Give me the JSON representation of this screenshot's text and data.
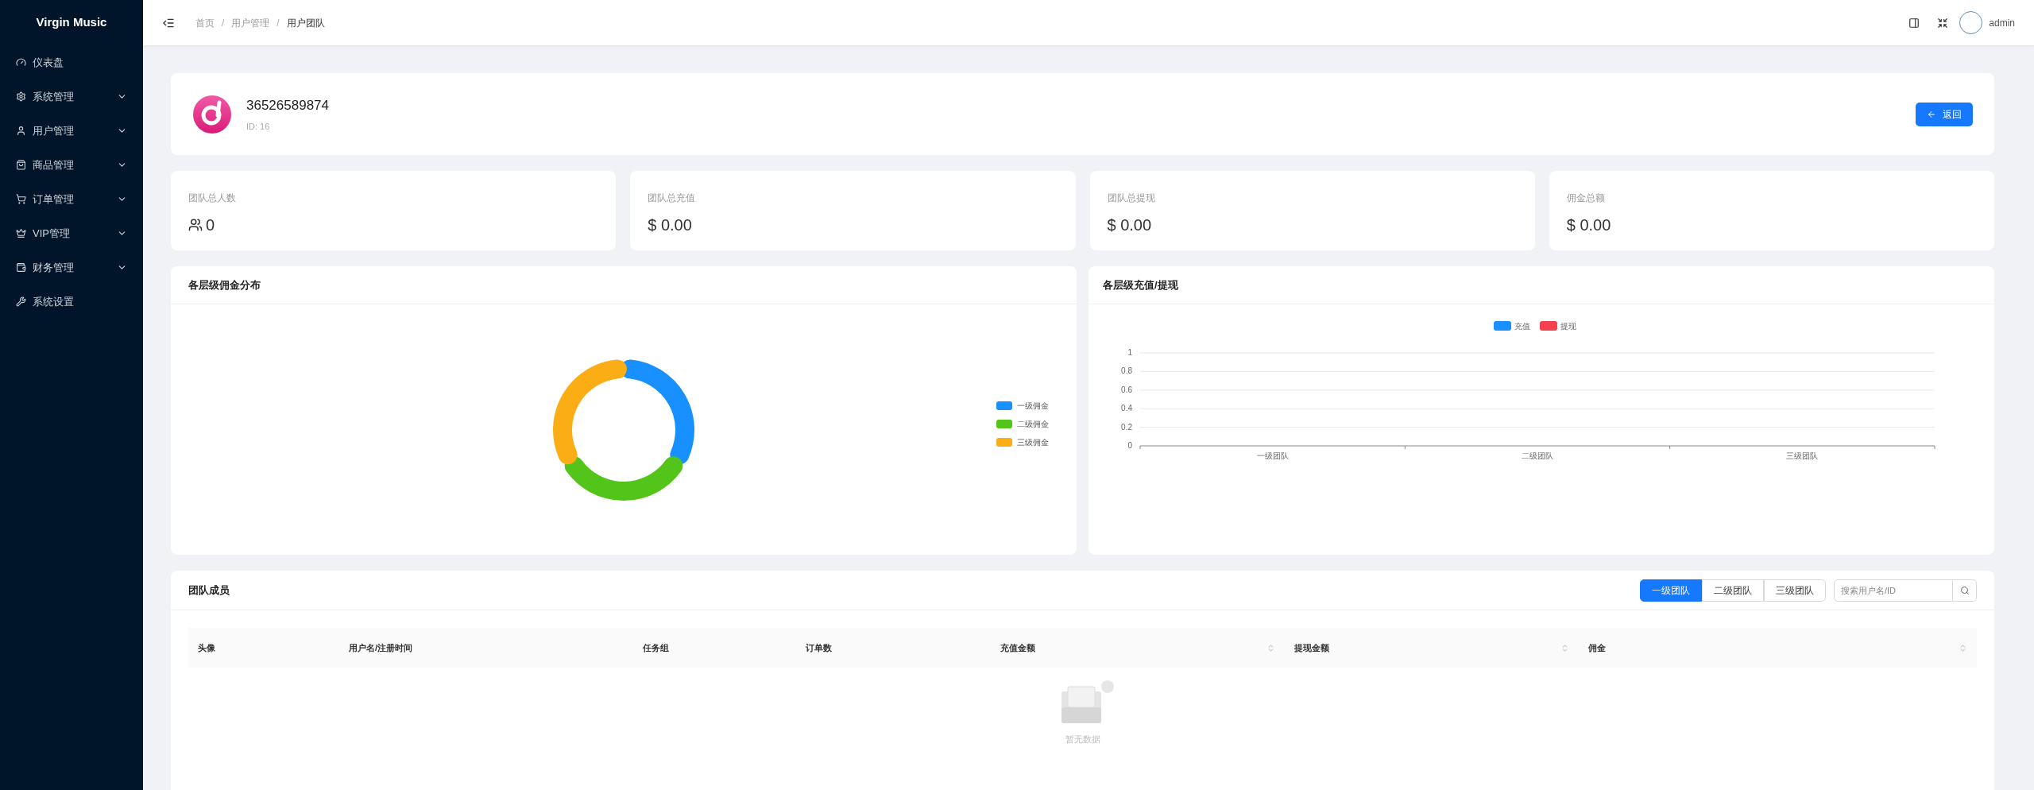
{
  "sidebar": {
    "brand": "Virgin Music",
    "items": [
      {
        "label": "仪表盘",
        "kind": "link"
      },
      {
        "label": "系统管理",
        "kind": "group"
      },
      {
        "label": "用户管理",
        "kind": "group"
      },
      {
        "label": "商品管理",
        "kind": "group"
      },
      {
        "label": "订单管理",
        "kind": "group"
      },
      {
        "label": "VIP管理",
        "kind": "group"
      },
      {
        "label": "财务管理",
        "kind": "group"
      },
      {
        "label": "系统设置",
        "kind": "link"
      }
    ]
  },
  "header": {
    "breadcrumb": [
      "首页",
      "用户管理",
      "用户团队"
    ],
    "separator": "/",
    "user": "admin"
  },
  "profile": {
    "name": "36526589874",
    "id_text": "ID: 16",
    "back_button": "返回"
  },
  "stats": [
    {
      "label": "团队总人数",
      "value": "0",
      "kind": "count"
    },
    {
      "label": "团队总充值",
      "value": "$ 0.00",
      "kind": "money"
    },
    {
      "label": "团队总提现",
      "value": "$ 0.00",
      "kind": "money"
    },
    {
      "label": "佣金总额",
      "value": "$ 0.00",
      "kind": "money"
    }
  ],
  "commission_chart": {
    "title": "各层级佣金分布",
    "legend": [
      {
        "label": "一级佣金",
        "color": "#1890ff"
      },
      {
        "label": "二级佣金",
        "color": "#52c41a"
      },
      {
        "label": "三级佣金",
        "color": "#faad14"
      }
    ]
  },
  "flow_chart": {
    "title": "各层级充值/提现",
    "chart_data": {
      "type": "bar",
      "categories": [
        "一级团队",
        "二级团队",
        "三级团队"
      ],
      "series": [
        {
          "name": "充值",
          "color": "#1890ff",
          "values": [
            0,
            0,
            0
          ]
        },
        {
          "name": "提现",
          "color": "#f5414d",
          "values": [
            0,
            0,
            0
          ]
        }
      ],
      "ylim": [
        0,
        1
      ],
      "yticks": [
        0,
        0.2,
        0.4,
        0.6,
        0.8,
        1
      ],
      "grid": true
    }
  },
  "members": {
    "title": "团队成员",
    "tabs": [
      {
        "label": "一级团队",
        "selected": true
      },
      {
        "label": "二级团队",
        "selected": false
      },
      {
        "label": "三级团队",
        "selected": false
      }
    ],
    "search": {
      "placeholder": "搜索用户名/ID"
    },
    "columns": [
      {
        "label": "头像",
        "sortable": false
      },
      {
        "label": "用户名/注册时间",
        "sortable": false
      },
      {
        "label": "任务组",
        "sortable": false
      },
      {
        "label": "订单数",
        "sortable": false
      },
      {
        "label": "充值金额",
        "sortable": true
      },
      {
        "label": "提现金额",
        "sortable": true
      },
      {
        "label": "佣金",
        "sortable": true
      }
    ],
    "empty_text": "暂无数据"
  }
}
